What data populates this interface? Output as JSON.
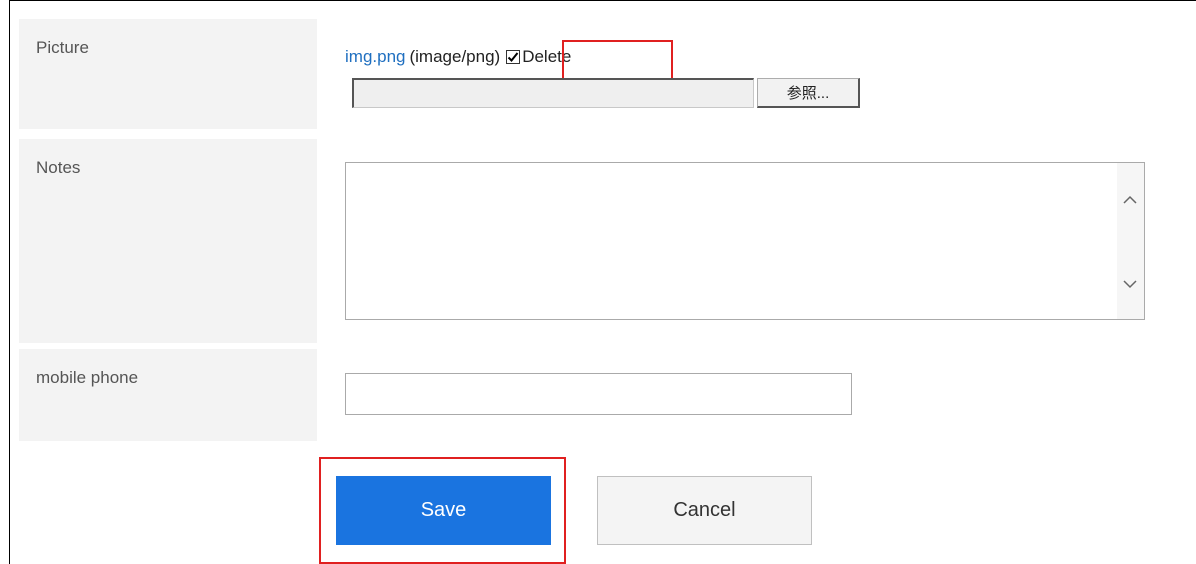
{
  "fields": {
    "picture": {
      "label": "Picture",
      "file_name": "img.png",
      "file_type": "(image/png)",
      "delete_label": "Delete",
      "delete_checked": true,
      "browse_label": "参照..."
    },
    "notes": {
      "label": "Notes",
      "value": ""
    },
    "mobile_phone": {
      "label": "mobile phone",
      "value": ""
    }
  },
  "actions": {
    "save_label": "Save",
    "cancel_label": "Cancel"
  },
  "colors": {
    "accent": "#1a74e0",
    "highlight": "#e02020",
    "link": "#1f6fc0",
    "label_bg": "#f3f3f3"
  }
}
